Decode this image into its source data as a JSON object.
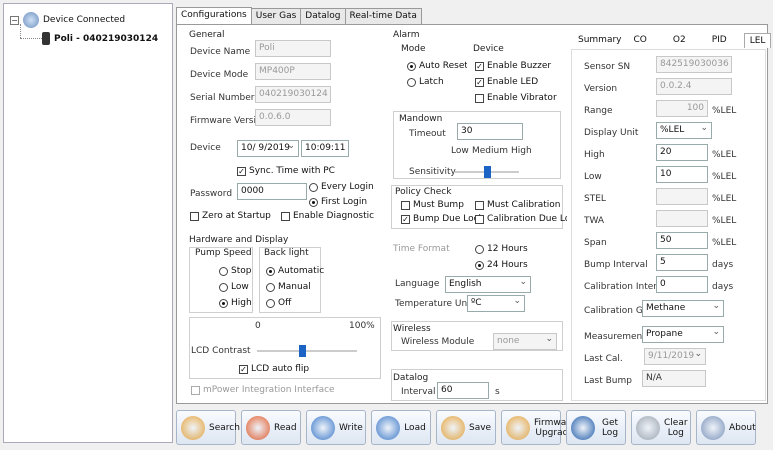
{
  "tree": {
    "root": "Device Connected",
    "child": "Poli - 040219030124"
  },
  "tabs": [
    "Configurations",
    "User Gas",
    "Datalog",
    "Real-time Data"
  ],
  "general": {
    "title": "General",
    "device_name_label": "Device Name",
    "device_name": "Poli",
    "device_mode_label": "Device Mode",
    "device_mode": "MP400P",
    "serial_label": "Serial Number",
    "serial": "040219030124",
    "firmware_label": "Firmware Version",
    "firmware": "0.0.6.0",
    "device_label": "Device",
    "date": "10/ 9/2019",
    "time": "10:09:11",
    "sync_label": "Sync. Time with PC",
    "password_label": "Password",
    "password": "0000",
    "every_login": "Every Login",
    "first_login": "First Login",
    "zero_label": "Zero at Startup",
    "diag_label": "Enable Diagnostic"
  },
  "hardware": {
    "title": "Hardware and Display",
    "pump_title": "Pump Speed",
    "pump_options": [
      "Stop",
      "Low",
      "High"
    ],
    "back_title": "Back light",
    "back_options": [
      "Automatic",
      "Manual",
      "Off"
    ],
    "lcd_label": "LCD Contrast",
    "lcd_min": "0",
    "lcd_max": "100%",
    "lcd_value_fraction": 0.45,
    "autoflip_label": "LCD auto flip",
    "mpower_label": "mPower Integration Interface"
  },
  "alarm": {
    "title": "Alarm",
    "mode_title": "Mode",
    "mode_options": [
      "Auto Reset",
      "Latch"
    ],
    "device_title": "Device",
    "buzzer": "Enable Buzzer",
    "led": "Enable LED",
    "vibrator": "Enable Vibrator"
  },
  "mandown": {
    "title": "Mandown",
    "timeout_label": "Timeout",
    "timeout": "30",
    "levels": [
      "Low",
      "Medium",
      "High"
    ],
    "sensitivity_label": "Sensitivity",
    "sensitivity_fraction": 0.5
  },
  "policy": {
    "title": "Policy Check",
    "must_bump": "Must Bump",
    "must_cal": "Must Calibration",
    "bump_lock": "Bump Due Lock",
    "cal_lock": "Calibration Due Lock"
  },
  "misc": {
    "time_format_label": "Time Format",
    "time_options": [
      "12 Hours",
      "24 Hours"
    ],
    "language_label": "Language",
    "language": "English",
    "temp_label": "Temperature Unit",
    "temp": "ºC"
  },
  "wireless": {
    "title": "Wireless",
    "module_label": "Wireless Module",
    "module": "none"
  },
  "datalog": {
    "title": "Datalog",
    "interval_label": "Interval",
    "interval": "60",
    "unit": "s"
  },
  "sensor_tabs": [
    "Summary",
    "CO",
    "O2",
    "PID",
    "LEL"
  ],
  "sensor": {
    "sn_label": "Sensor SN",
    "sn": "842519030036",
    "version_label": "Version",
    "version": "0.0.2.4",
    "range_label": "Range",
    "range": "100",
    "range_unit": "%LEL",
    "display_unit_label": "Display Unit",
    "display_unit": "%LEL",
    "high_label": "High",
    "high": "20",
    "high_unit": "%LEL",
    "low_label": "Low",
    "low": "10",
    "low_unit": "%LEL",
    "stel_label": "STEL",
    "stel_unit": "%LEL",
    "twa_label": "TWA",
    "twa_unit": "%LEL",
    "span_label": "Span",
    "span": "50",
    "span_unit": "%LEL",
    "bump_label": "Bump Interval",
    "bump": "5",
    "bump_unit": "days",
    "cal_label": "Calibration Interval",
    "cal": "0",
    "cal_unit": "days",
    "calgas_label": "Calibration Gas",
    "calgas": "Methane",
    "measgas_label": "Measurement Gas",
    "measgas": "Propane",
    "lastcal_label": "Last Cal.",
    "lastcal": "9/11/2019",
    "lastbump_label": "Last Bump",
    "lastbump": "N/A"
  },
  "toolbar": [
    {
      "label": "Search",
      "icon": "search-icon",
      "color": "#e3a23a"
    },
    {
      "label": "Read",
      "icon": "read-icon",
      "color": "#e05a2a"
    },
    {
      "label": "Write",
      "icon": "write-icon",
      "color": "#3a78c8"
    },
    {
      "label": "Load",
      "icon": "load-icon",
      "color": "#3a78c8"
    },
    {
      "label": "Save",
      "icon": "save-icon",
      "color": "#e3a23a"
    },
    {
      "label": "Firmware Upgrade",
      "icon": "firmware-icon",
      "color": "#e3a23a"
    },
    {
      "label": "Get Log",
      "icon": "get-log-icon",
      "color": "#1e5aa8"
    },
    {
      "label": "Clear Log",
      "icon": "clear-log-icon",
      "color": "#9aa3ad"
    },
    {
      "label": "About",
      "icon": "about-icon",
      "color": "#7a92b8"
    }
  ]
}
